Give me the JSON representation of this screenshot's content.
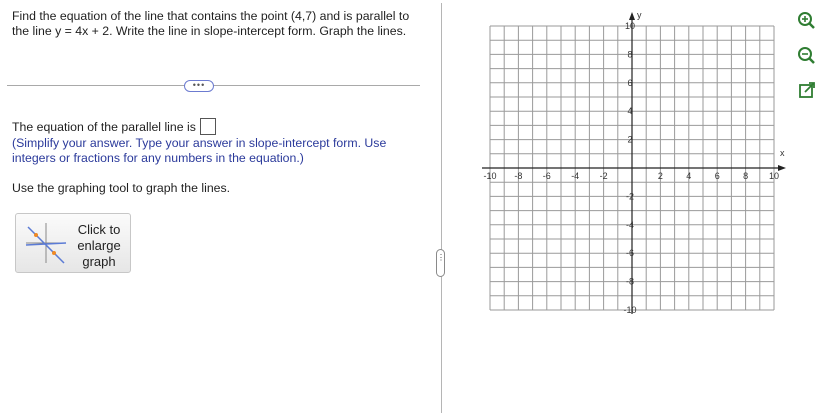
{
  "question": {
    "text": "Find the equation of the line that contains the point (4,7) and is parallel to the line y = 4x + 2. Write the line in slope-intercept form. Graph the lines."
  },
  "more_button": {
    "label": "•••"
  },
  "answer": {
    "prompt": "The equation of the parallel line is",
    "value": ""
  },
  "hint": "(Simplify your answer. Type your answer in slope-intercept form. Use integers or fractions for any numbers in the equation.)",
  "graph_instruction": "Use the graphing tool to graph the lines.",
  "enlarge_button": {
    "label": "Click to\nenlarge\ngraph"
  },
  "panel_handle": {
    "label": "⋮"
  },
  "graph": {
    "xmin": -10,
    "xmax": 10,
    "ymin": -10,
    "ymax": 10,
    "grid_step": 1,
    "x_axis_label": "x",
    "y_axis_label": "y",
    "x_tick_labels": [
      "-10",
      "-8",
      "-6",
      "-4",
      "-2",
      "2",
      "4",
      "6",
      "8",
      "10"
    ],
    "y_tick_labels": [
      "10",
      "8",
      "6",
      "4",
      "2",
      "-2",
      "-4",
      "-6",
      "-8",
      "-10"
    ]
  },
  "side_tools": [
    {
      "name": "zoom-in-icon"
    },
    {
      "name": "zoom-out-icon"
    },
    {
      "name": "new-window-icon"
    }
  ],
  "colors": {
    "hint": "#2b3a9b",
    "grid": "#9a9a9a",
    "axis": "#222222",
    "tool_icon": "#2f7d32"
  }
}
